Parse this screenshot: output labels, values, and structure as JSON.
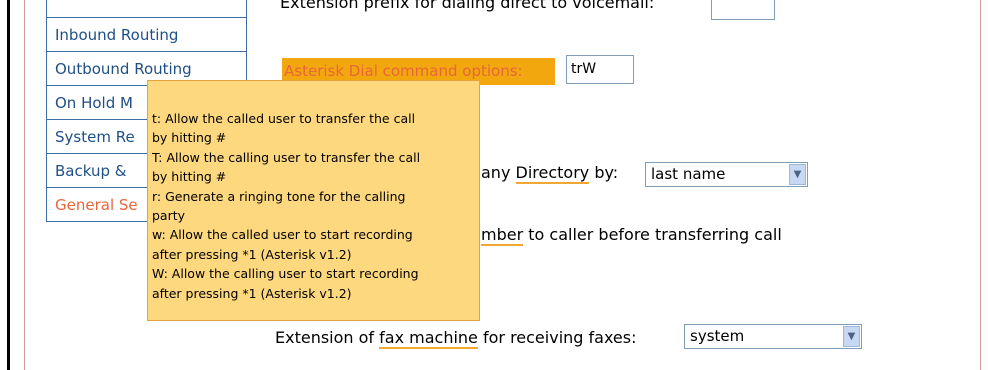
{
  "sidebar": {
    "items": [
      {
        "label": ""
      },
      {
        "label": "Inbound Routing"
      },
      {
        "label": "Outbound Routing"
      },
      {
        "label": "On Hold M"
      },
      {
        "label": "System Re"
      },
      {
        "label": "Backup &"
      },
      {
        "label": "General Se"
      }
    ]
  },
  "content": {
    "voicemail_prefix_label": "Extension prefix for dialing direct to voicemail:",
    "dial_options_label": "Asterisk Dial command options:",
    "dial_options_value": "trW",
    "directory_label_prefix": "any ",
    "directory_label_link": "Directory",
    "directory_label_suffix": " by:",
    "directory_select_value": "last name",
    "announce_label_link": "mber",
    "announce_label_suffix": " to caller before transferring call",
    "fax_label_prefix": "Extension of ",
    "fax_label_link": "fax machine",
    "fax_label_suffix": " for receiving faxes:",
    "fax_select_value": "system"
  },
  "tooltip": {
    "lines": [
      "t: Allow the called user to transfer the call",
      "by hitting #",
      "T: Allow the calling user to transfer the call",
      "by hitting #",
      "r:  Generate  a  ringing  tone  for  the  calling",
      "party",
      "w: Allow the called user to start recording",
      "after pressing *1 (Asterisk v1.2)",
      "W: Allow the calling user to start recording",
      "after pressing *1 (Asterisk v1.2)"
    ]
  }
}
